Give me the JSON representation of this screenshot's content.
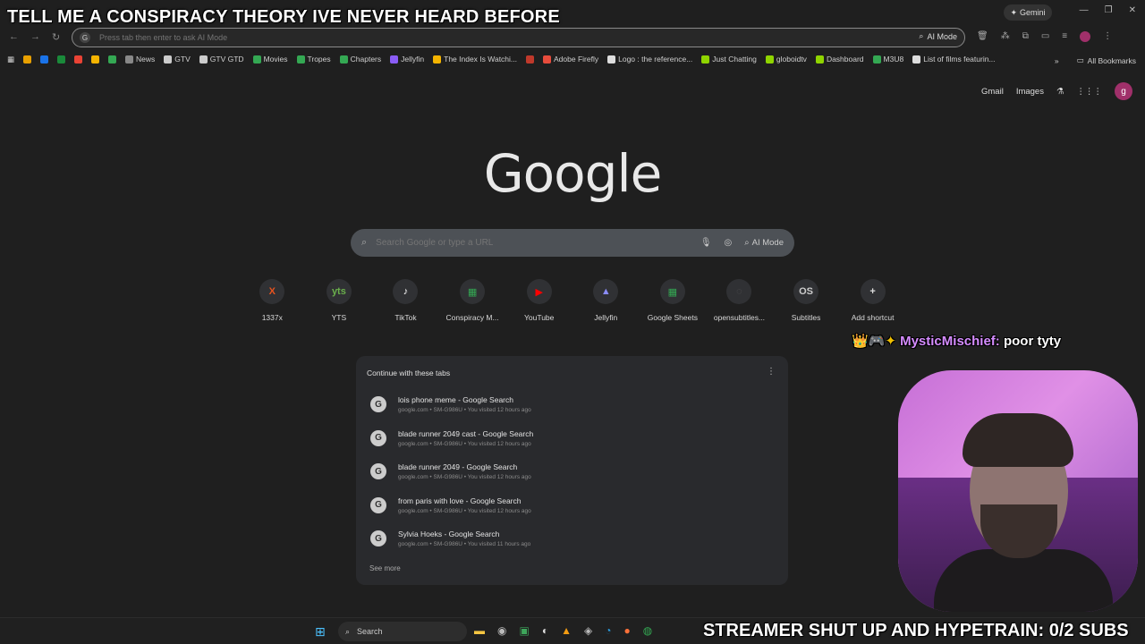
{
  "overlay": {
    "top_text": "TELL ME A CONSPIRACY THEORY IVE NEVER HEARD BEFORE",
    "bottom_text": "STREAMER SHUT UP AND HYPETRAIN: 0/2 SUBS"
  },
  "chat": {
    "badges": "👑🎮✦",
    "username": "MysticMischief:",
    "message": "poor tyty"
  },
  "titlebar": {
    "gemini_label": "Gemini"
  },
  "omnibox": {
    "placeholder": "Press tab then enter to ask AI Mode",
    "ai_mode_label": "AI Mode"
  },
  "bookmarks": [
    {
      "label": "",
      "color": "#e8a000"
    },
    {
      "label": "",
      "color": "#1a73e8"
    },
    {
      "label": "",
      "color": "#1a8a3a"
    },
    {
      "label": "",
      "color": "#ea4335"
    },
    {
      "label": "",
      "color": "#f4b400"
    },
    {
      "label": "",
      "color": "#34a853"
    },
    {
      "label": "News",
      "color": "#888888"
    },
    {
      "label": "GTV",
      "color": "#cccccc"
    },
    {
      "label": "GTV GTD",
      "color": "#cccccc"
    },
    {
      "label": "Movies",
      "color": "#34a853"
    },
    {
      "label": "Tropes",
      "color": "#34a853"
    },
    {
      "label": "Chapters",
      "color": "#34a853"
    },
    {
      "label": "Jellyfin",
      "color": "#8a5cf6"
    },
    {
      "label": "The Index Is Watchi...",
      "color": "#f4b400"
    },
    {
      "label": "",
      "color": "#c0392b"
    },
    {
      "label": "Adobe Firefly",
      "color": "#e74c3c"
    },
    {
      "label": "Logo : the reference...",
      "color": "#dddddd"
    },
    {
      "label": "Just Chatting",
      "color": "#8fd400"
    },
    {
      "label": "globoidtv",
      "color": "#8fd400"
    },
    {
      "label": "Dashboard",
      "color": "#8fd400"
    },
    {
      "label": "M3U8",
      "color": "#34a853"
    },
    {
      "label": "List of films featurin...",
      "color": "#dddddd"
    }
  ],
  "all_bookmarks": "All Bookmarks",
  "google": {
    "gmail": "Gmail",
    "images": "Images",
    "avatar": "g",
    "logo": "Google",
    "search_placeholder": "Search Google or type a URL",
    "ai_mode": "AI Mode"
  },
  "shortcuts": [
    {
      "label": "1337x",
      "glyph": "X",
      "color": "#e8531f"
    },
    {
      "label": "YTS",
      "glyph": "yts",
      "color": "#6ab04c"
    },
    {
      "label": "TikTok",
      "glyph": "♪",
      "color": "#ffffff"
    },
    {
      "label": "Conspiracy M...",
      "glyph": "▦",
      "color": "#34a853"
    },
    {
      "label": "YouTube",
      "glyph": "▶",
      "color": "#ff0000"
    },
    {
      "label": "Jellyfin",
      "glyph": "▲",
      "color": "#8a8cf6"
    },
    {
      "label": "Google Sheets",
      "glyph": "▦",
      "color": "#34a853"
    },
    {
      "label": "opensubtitles...",
      "glyph": "◌",
      "color": "#555555"
    },
    {
      "label": "Subtitles",
      "glyph": "OS",
      "color": "#cccccc"
    },
    {
      "label": "Add shortcut",
      "glyph": "+",
      "color": "#dddddd"
    }
  ],
  "continue_tabs": {
    "title": "Continue with these tabs",
    "see_more": "See more",
    "items": [
      {
        "title": "lois phone meme - Google Search",
        "sub": "google.com • SM-G986U • You visited 12 hours ago"
      },
      {
        "title": "blade runner 2049 cast - Google Search",
        "sub": "google.com • SM-G986U • You visited 12 hours ago"
      },
      {
        "title": "blade runner 2049 - Google Search",
        "sub": "google.com • SM-G986U • You visited 12 hours ago"
      },
      {
        "title": "from paris with love - Google Search",
        "sub": "google.com • SM-G986U • You visited 12 hours ago"
      },
      {
        "title": "Sylvia Hoeks - Google Search",
        "sub": "google.com • SM-G986U • You visited 11 hours ago"
      }
    ]
  },
  "taskbar": {
    "search_label": "Search"
  }
}
